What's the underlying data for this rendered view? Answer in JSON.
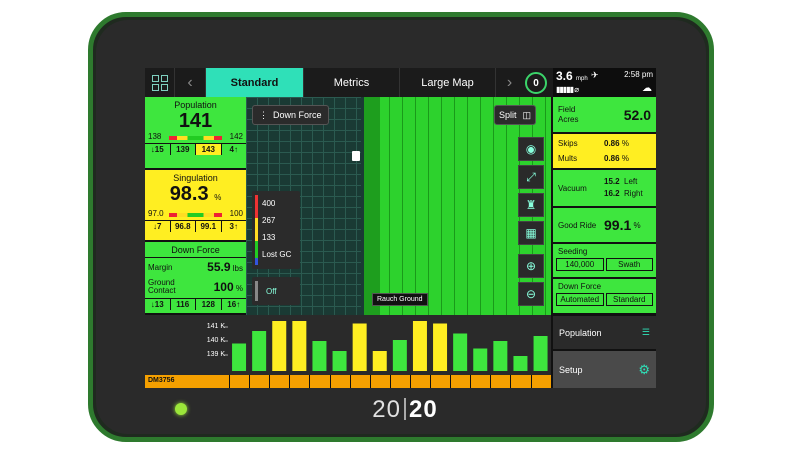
{
  "brand": {
    "n1": "20",
    "n2": "20"
  },
  "nav": {
    "tabs": [
      {
        "label": "Standard",
        "active": true
      },
      {
        "label": "Metrics",
        "active": false
      },
      {
        "label": "Large Map",
        "active": false
      }
    ],
    "left_arrow": "‹",
    "right_arrow": "›",
    "timer_value": "0"
  },
  "status": {
    "speed": "3.6",
    "speed_unit": "mph",
    "time": "2:58 pm"
  },
  "population": {
    "title": "Population",
    "value": "141",
    "min": "138",
    "max": "142",
    "stats": [
      "↓15",
      "139",
      "143",
      "4↑"
    ]
  },
  "singulation": {
    "title": "Singulation",
    "value": "98.3",
    "unit": "%",
    "min": "97.0",
    "max": "100",
    "stats": [
      "↓7",
      "96.8",
      "99.1",
      "3↑"
    ]
  },
  "down_force_left": {
    "title": "Down Force",
    "margin_label": "Margin",
    "margin_value": "55.9",
    "margin_unit": "lbs",
    "ground_label_1": "Ground",
    "ground_label_2": "Contact",
    "ground_value": "100",
    "ground_unit": "%",
    "stats": [
      "↓13",
      "116",
      "128",
      "16↑"
    ]
  },
  "map": {
    "layer_label": "Down Force",
    "split_label": "Split",
    "legend": [
      "400",
      "267",
      "133",
      "Lost GC"
    ],
    "off_label": "Off",
    "rauch_label": "Rauch Ground",
    "tools": [
      "compass-icon",
      "expand-icon",
      "planter-icon",
      "calc-icon",
      "zoom-in-icon",
      "zoom-out-icon"
    ]
  },
  "chart_data": {
    "type": "bar",
    "y_ticks": [
      "141 K",
      "140 K",
      "139 K"
    ],
    "values": [
      0.55,
      0.8,
      1.0,
      1.0,
      0.6,
      0.4,
      0.95,
      0.4,
      0.62,
      1.0,
      0.95,
      0.75,
      0.45,
      0.6,
      0.3,
      0.7
    ],
    "colors": [
      "#3ee63e",
      "#3ee63e",
      "#ffee22",
      "#ffee22",
      "#3ee63e",
      "#3ee63e",
      "#ffee22",
      "#ffee22",
      "#3ee63e",
      "#ffee22",
      "#ffee22",
      "#3ee63e",
      "#3ee63e",
      "#3ee63e",
      "#3ee63e",
      "#3ee63e"
    ]
  },
  "unit_label": "DM3756",
  "right": {
    "field_label_1": "Field",
    "field_label_2": "Acres",
    "field_value": "52.0",
    "skips_label": "Skips",
    "skips_value": "0.86",
    "mults_label": "Mults",
    "mults_value": "0.86",
    "pct": "%",
    "vacuum_label": "Vacuum",
    "vac_left": "15.2",
    "vac_left_label": "Left",
    "vac_right": "16.2",
    "vac_right_label": "Right",
    "goodride_label": "Good Ride",
    "goodride_value": "99.1",
    "seeding_label": "Seeding",
    "seeding_rate": "140,000",
    "seeding_mode": "Swath",
    "df_label": "Down Force",
    "df_auto": "Automated",
    "df_std": "Standard",
    "population_btn": "Population",
    "setup_btn": "Setup"
  },
  "colors": {
    "accent": "#2fe0b8",
    "green": "#3ee63e",
    "yellow": "#ffee22",
    "orange": "#f5a000"
  }
}
